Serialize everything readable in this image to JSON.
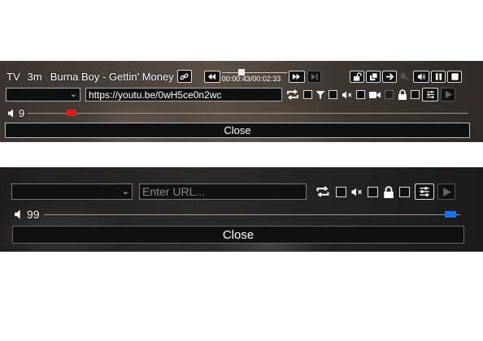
{
  "player1": {
    "source_label": "TV",
    "duration_label": "3m",
    "title": "Burna Boy - Gettin' Money",
    "time_current": "00:00:43",
    "time_total": "00:02:33",
    "time_display": "00:00:43/00:02:33",
    "progress": 0.28,
    "url_value": "https://youtu.be/0wH5ce0n2wc",
    "dropdown_value": "",
    "volume": "9",
    "volume_level": 0.09,
    "volume_color": "#e01b1b",
    "close_label": "Close"
  },
  "player2": {
    "dropdown_value": "",
    "url_placeholder": "Enter URL...",
    "volume": "99",
    "volume_level": 0.99,
    "volume_color": "#1a73e8",
    "close_label": "Close"
  },
  "icons": {
    "link": "link-icon",
    "rewind": "rewind-icon",
    "fast_forward": "fast-forward-icon",
    "skip_next": "skip-next-icon",
    "unlock": "unlock-icon",
    "copy": "copy-icon",
    "arrow_right": "arrow-right-icon",
    "mute_crossed": "mute-icon",
    "volume": "volume-up-icon",
    "pause": "pause-icon",
    "stop": "stop-icon",
    "repeat": "repeat-icon",
    "filter": "filter-icon",
    "video": "video-camera-icon",
    "lock": "lock-icon",
    "settings": "sliders-icon",
    "play": "play-icon",
    "speaker": "speaker-icon"
  }
}
